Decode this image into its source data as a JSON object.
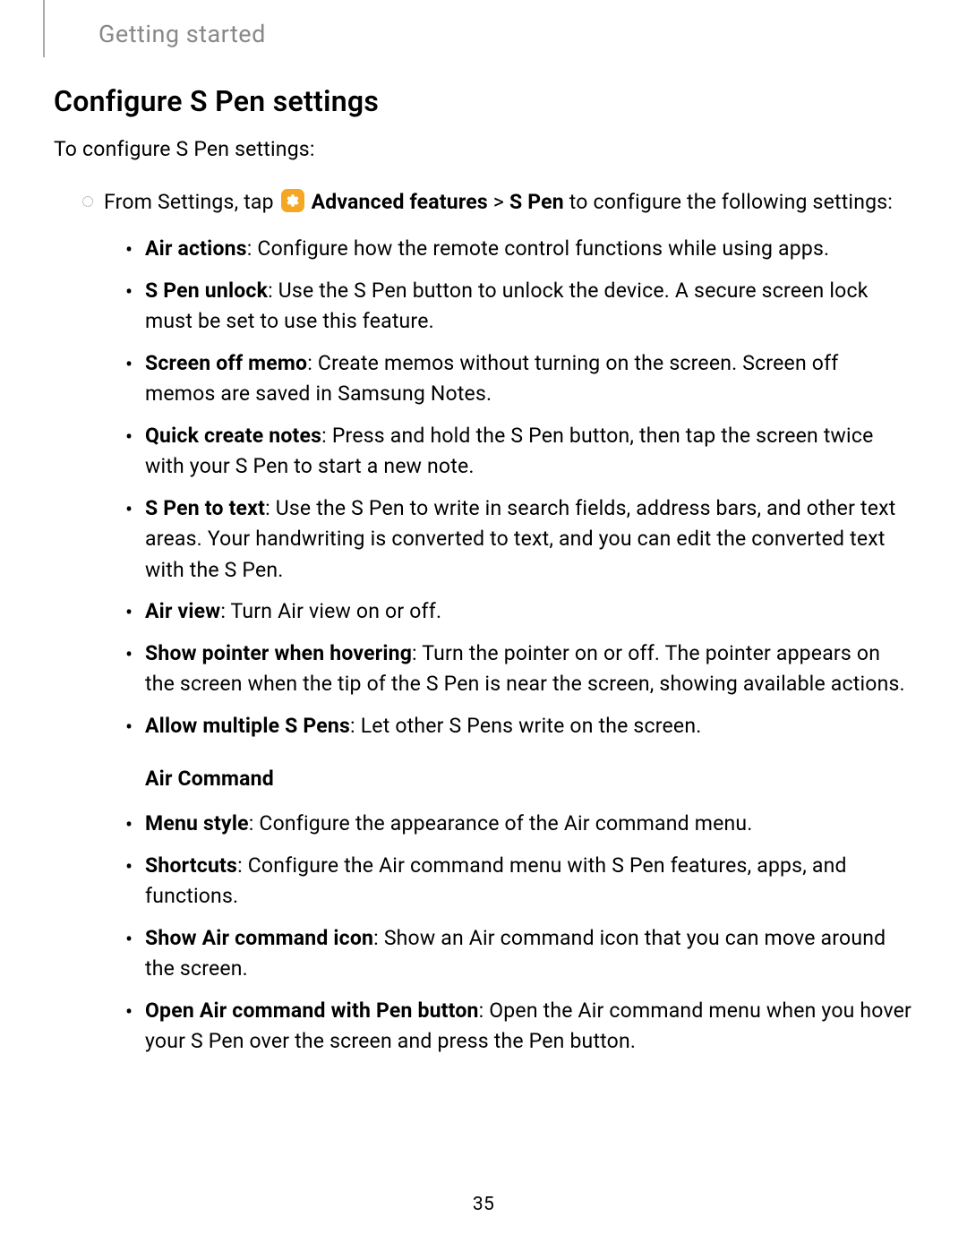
{
  "header": {
    "section": "Getting started"
  },
  "title": "Configure S Pen settings",
  "intro": "To configure S Pen settings:",
  "instruction": {
    "prefix": "From Settings, tap ",
    "icon_label": "Advanced features",
    "path": " > ",
    "target": "S Pen",
    "suffix": " to configure the following settings:"
  },
  "settings": [
    {
      "name": "Air actions",
      "desc": ": Configure how the remote control functions while using apps."
    },
    {
      "name": "S Pen unlock",
      "desc": ": Use the S Pen button to unlock the device. A secure screen lock must be set to use this feature."
    },
    {
      "name": "Screen off memo",
      "desc": ": Create memos without turning on the screen. Screen off memos are saved in Samsung Notes."
    },
    {
      "name": "Quick create notes",
      "desc": ": Press and hold the S Pen button, then tap the screen twice with your S Pen to start a new note."
    },
    {
      "name": "S Pen to text",
      "desc": ": Use the S Pen to write in search fields, address bars, and other text areas. Your handwriting is converted to text, and you can edit the converted text with the S Pen."
    },
    {
      "name": "Air view",
      "desc": ": Turn Air view on or off."
    },
    {
      "name": "Show pointer when hovering",
      "desc": ": Turn the pointer on or off. The pointer appears on the screen when the tip of the S Pen is near the screen, showing available actions."
    },
    {
      "name": "Allow multiple S Pens",
      "desc": ": Let other S Pens write on the screen."
    }
  ],
  "subsection": {
    "title": "Air Command",
    "items": [
      {
        "name": "Menu style",
        "desc": ": Configure the appearance of the Air command menu."
      },
      {
        "name": "Shortcuts",
        "desc": ": Configure the Air command menu with S Pen features, apps, and functions."
      },
      {
        "name": "Show Air command icon",
        "desc": ": Show an Air command icon that you can move around the screen."
      },
      {
        "name": "Open Air command with Pen button",
        "desc": ": Open the Air command menu when you hover your S Pen over the screen and press the Pen button."
      }
    ]
  },
  "page_number": "35"
}
